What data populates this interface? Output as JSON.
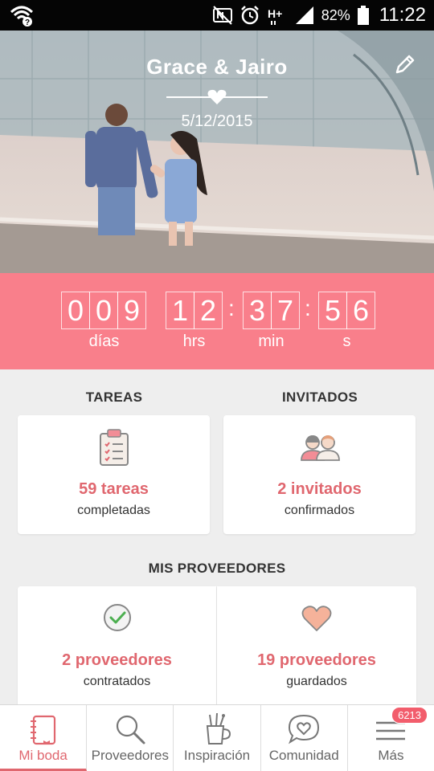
{
  "status_bar": {
    "battery": "82%",
    "time": "11:22"
  },
  "hero": {
    "couple": "Grace & Jairo",
    "date": "5/12/2015"
  },
  "countdown": {
    "days": [
      "0",
      "0",
      "9"
    ],
    "hours": [
      "1",
      "2"
    ],
    "minutes": [
      "3",
      "7"
    ],
    "seconds": [
      "5",
      "6"
    ],
    "separator": ":",
    "labels": {
      "days": "días",
      "hours": "hrs",
      "minutes": "min",
      "seconds": "s"
    }
  },
  "tasks": {
    "title": "TAREAS",
    "count": "59 tareas",
    "sub": "completadas"
  },
  "guests": {
    "title": "INVITADOS",
    "count": "2 invitados",
    "sub": "confirmados"
  },
  "vendors": {
    "title": "MIS PROVEEDORES",
    "hired": {
      "count": "2 proveedores",
      "sub": "contratados"
    },
    "saved": {
      "count": "19 proveedores",
      "sub": "guardados"
    }
  },
  "nav": {
    "items": [
      {
        "label": "Mi boda",
        "icon": "notebook-icon"
      },
      {
        "label": "Proveedores",
        "icon": "search-icon"
      },
      {
        "label": "Inspiración",
        "icon": "mug-pencils-icon"
      },
      {
        "label": "Comunidad",
        "icon": "chat-heart-icon"
      },
      {
        "label": "Más",
        "icon": "menu-icon"
      }
    ],
    "badge": "6213"
  },
  "colors": {
    "accent": "#f97f8b",
    "accent_text": "#e0676f"
  }
}
